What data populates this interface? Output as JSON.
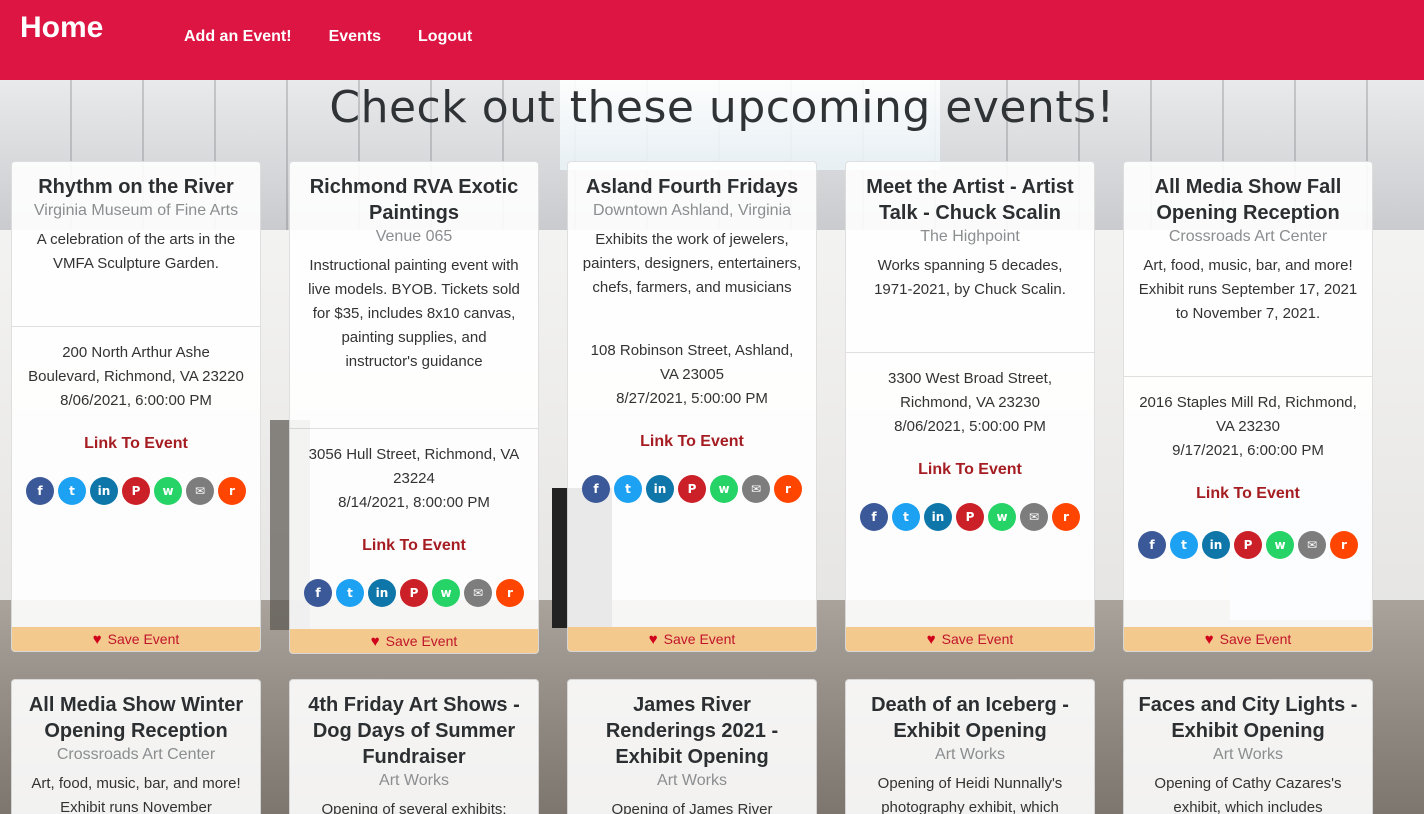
{
  "nav": {
    "brand": "Home",
    "links": [
      "Add an Event!",
      "Events",
      "Logout"
    ]
  },
  "page_title": "Check out these upcoming events!",
  "colors": {
    "header_bg": "#dc1543",
    "link": "#a51d22",
    "save_bar": "#f4c98e"
  },
  "share_icons": [
    "facebook-icon",
    "twitter-icon",
    "linkedin-icon",
    "pinterest-icon",
    "whatsapp-icon",
    "email-icon",
    "reddit-icon"
  ],
  "link_label": "Link To Event",
  "save_label": "Save Event",
  "events": [
    {
      "title": "Rhythm on the River",
      "venue": "Virginia Museum of Fine Arts",
      "description": "A celebration of the arts in the VMFA Sculpture Garden.",
      "address": "200 North Arthur Ashe Boulevard, Richmond, VA 23220",
      "datetime": "8/06/2021, 6:00:00 PM"
    },
    {
      "title": "Richmond RVA Exotic Paintings",
      "venue": "Venue 065",
      "description": "Instructional painting event with live models. BYOB. Tickets sold for $35, includes 8x10 canvas, painting supplies, and instructor's guidance",
      "address": "3056 Hull Street, Richmond, VA 23224",
      "datetime": "8/14/2021, 8:00:00 PM"
    },
    {
      "title": "Asland Fourth Fridays",
      "venue": "Downtown Ashland, Virginia",
      "description": "Exhibits the work of jewelers, painters, designers, entertainers, chefs, farmers, and musicians",
      "address": "108 Robinson Street, Ashland, VA 23005",
      "datetime": "8/27/2021, 5:00:00 PM"
    },
    {
      "title": "Meet the Artist - Artist Talk - Chuck Scalin",
      "venue": "The Highpoint",
      "description": "Works spanning 5 decades, 1971-2021, by Chuck Scalin.",
      "address": "3300 West Broad Street, Richmond, VA 23230",
      "datetime": "8/06/2021, 5:00:00 PM"
    },
    {
      "title": "All Media Show Fall Opening Reception",
      "venue": "Crossroads Art Center",
      "description": "Art, food, music, bar, and more! Exhibit runs September 17, 2021 to November 7, 2021.",
      "address": "2016 Staples Mill Rd, Richmond, VA 23230",
      "datetime": "9/17/2021, 6:00:00 PM"
    },
    {
      "title": "All Media Show Winter Opening Reception",
      "venue": "Crossroads Art Center",
      "description": "Art, food, music, bar, and more! Exhibit runs November"
    },
    {
      "title": "4th Friday Art Shows - Dog Days of Summer Fundraiser",
      "venue": "Art Works",
      "description": "Opening of several exhibits;"
    },
    {
      "title": "James River Renderings 2021 - Exhibit Opening",
      "venue": "Art Works",
      "description": "Opening of James River"
    },
    {
      "title": "Death of an Iceberg - Exhibit Opening",
      "venue": "Art Works",
      "description": "Opening of Heidi Nunnally's photography exhibit, which"
    },
    {
      "title": "Faces and City Lights - Exhibit Opening",
      "venue": "Art Works",
      "description": "Opening of Cathy Cazares's exhibit, which includes"
    }
  ]
}
